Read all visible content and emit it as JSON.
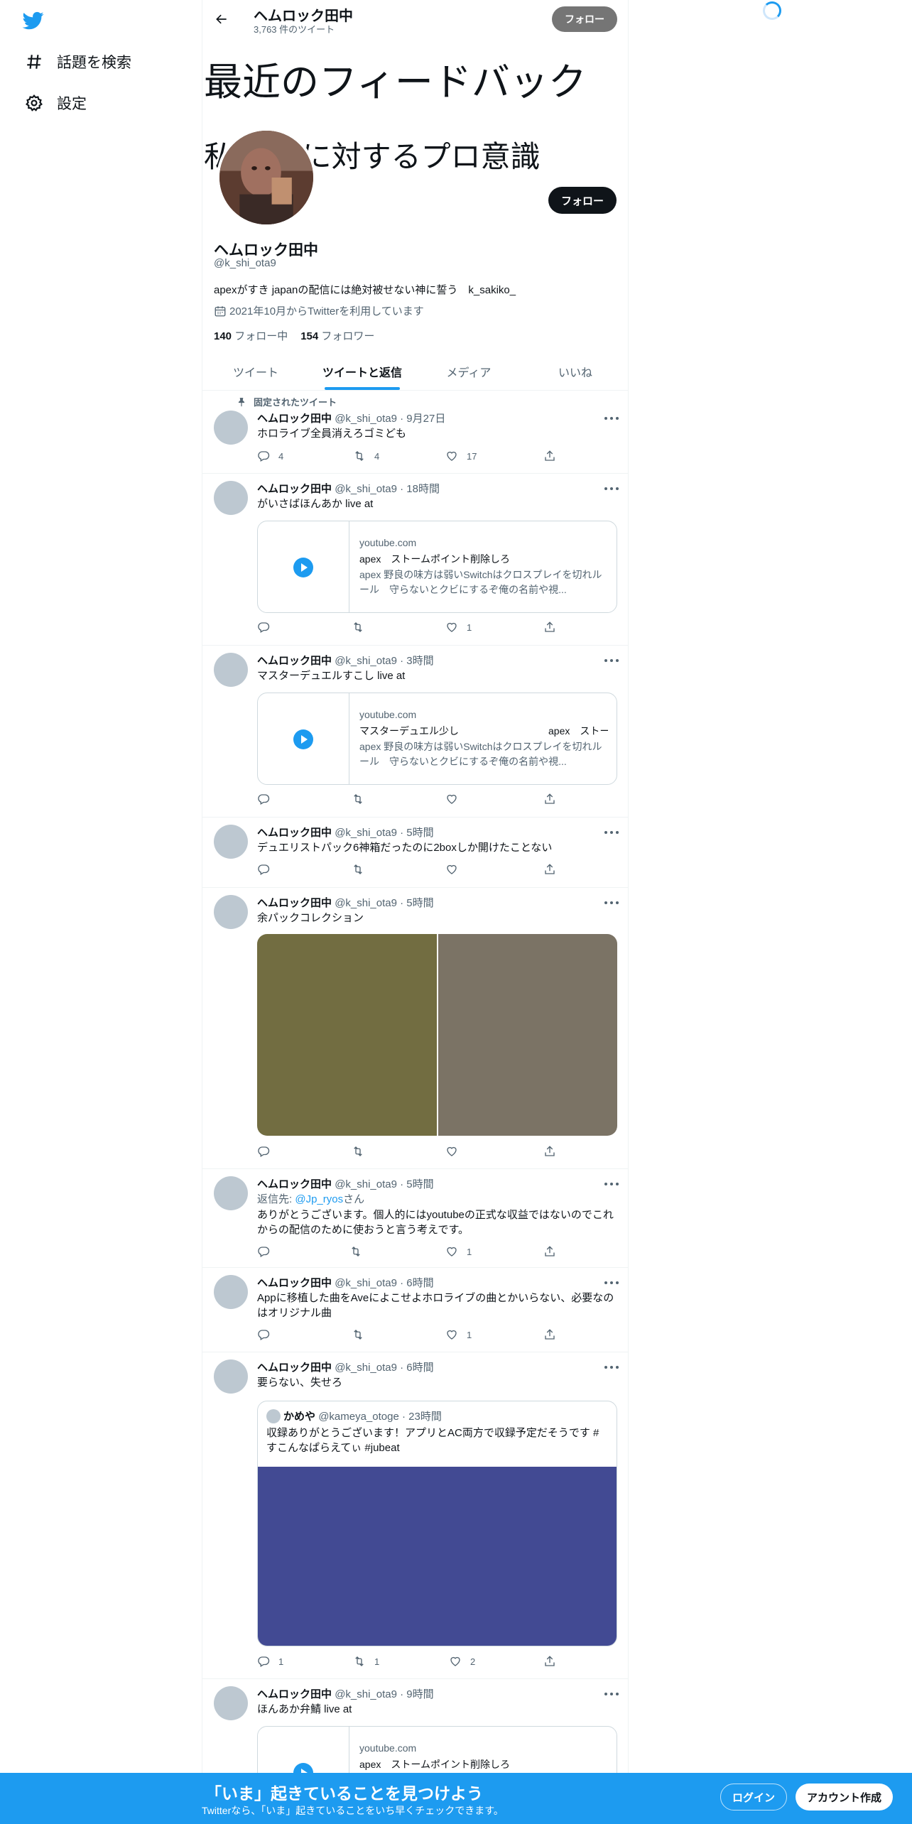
{
  "nav": {
    "explore_label": "話題を検索",
    "settings_label": "設定"
  },
  "header": {
    "name": "ヘムロック田中",
    "tweet_count": "3,763 件のツイート",
    "follow_label": "フォロー"
  },
  "banner": {
    "line1": "最近のフィードバック",
    "line2": "私 　　に対するプロ意識"
  },
  "profile": {
    "name": "ヘムロック田中",
    "handle": "@k_shi_ota9",
    "bio": "apexがすき japanの配信には絶対被せない神に誓う　k_sakiko_",
    "joined": "2021年10月からTwitterを利用しています",
    "following_count": "140",
    "following_label": "フォロー中",
    "followers_count": "154",
    "followers_label": "フォロワー",
    "follow_label": "フォロー"
  },
  "tabs": [
    "ツイート",
    "ツイートと返信",
    "メディア",
    "いいね"
  ],
  "tweets": [
    {
      "pinned_label": "固定されたツイート",
      "name": "ヘムロック田中",
      "meta": "@k_shi_ota9 · 9月27日",
      "text": "ホロライブ全員消えろゴミども",
      "replies": "4",
      "retweets": "4",
      "likes": "17"
    },
    {
      "name": "ヘムロック田中",
      "meta": "@k_shi_ota9 · 18時間",
      "text": "がいさばほんあか live at",
      "card": {
        "domain": "youtube.com",
        "title": "apex　ストームポイント削除しろ",
        "desc": "apex 野良の味方は弱いSwitchはクロスプレイを切れルール　守らないとクビにするぞ俺の名前や視..."
      },
      "replies": "",
      "retweets": "",
      "likes": "1"
    },
    {
      "name": "ヘムロック田中",
      "meta": "@k_shi_ota9 · 3時間",
      "text": "マスターデュエルすこし live at",
      "card": {
        "domain": "youtube.com",
        "title": "マスターデュエル少し　　　　　　　　　apex　ストームポイント削除しろ",
        "desc": "apex 野良の味方は弱いSwitchはクロスプレイを切れルール　守らないとクビにするぞ俺の名前や視..."
      },
      "replies": "",
      "retweets": "",
      "likes": ""
    },
    {
      "name": "ヘムロック田中",
      "meta": "@k_shi_ota9 · 5時間",
      "text": "デュエリストパック6神箱だったのに2boxしか開けたことない",
      "replies": "",
      "retweets": "",
      "likes": ""
    },
    {
      "name": "ヘムロック田中",
      "meta": "@k_shi_ota9 · 5時間",
      "text": "余パックコレクション",
      "replies": "",
      "retweets": "",
      "likes": ""
    },
    {
      "name": "ヘムロック田中",
      "meta": "@k_shi_ota9 · 5時間",
      "reply_prefix": "返信先: ",
      "reply_to": "@Jp_ryos",
      "reply_suffix": "さん",
      "text": "ありがとうございます。個人的にはyoutubeの正式な収益ではないのでこれからの配信のために使おうと言う考えです。",
      "replies": "",
      "retweets": "",
      "likes": "1"
    },
    {
      "name": "ヘムロック田中",
      "meta": "@k_shi_ota9 · 6時間",
      "text": "Appに移植した曲をAveによこせよホロライブの曲とかいらない、必要なのはオリジナル曲",
      "replies": "",
      "retweets": "",
      "likes": "1"
    },
    {
      "name": "ヘムロック田中",
      "meta": "@k_shi_ota9 · 6時間",
      "text": "要らない、失せろ",
      "quote": {
        "name": "かめや",
        "meta": "@kameya_otoge · 23時間",
        "text": "収録ありがとうございます！アプリとAC両方で収録予定だそうです #すこんなぱらえてぃ #jubeat"
      },
      "replies": "1",
      "retweets": "1",
      "likes": "2"
    },
    {
      "name": "ヘムロック田中",
      "meta": "@k_shi_ota9 · 9時間",
      "text": "ほんあか弁鯖 live at",
      "card": {
        "domain": "youtube.com",
        "title": "apex　ストームポイント削除しろ",
        "desc": ""
      }
    }
  ],
  "bottom_bar": {
    "title": "「いま」起きていることを見つけよう",
    "subtitle": "Twitterなら、「いま」起きていることをいち早くチェックできます。",
    "login_label": "ログイン",
    "signup_label": "アカウント作成"
  },
  "colors": {
    "accent": "#1d9bf0",
    "media_left": "#726d41",
    "media_right": "#7b7365",
    "quote_media": "#424a93"
  }
}
